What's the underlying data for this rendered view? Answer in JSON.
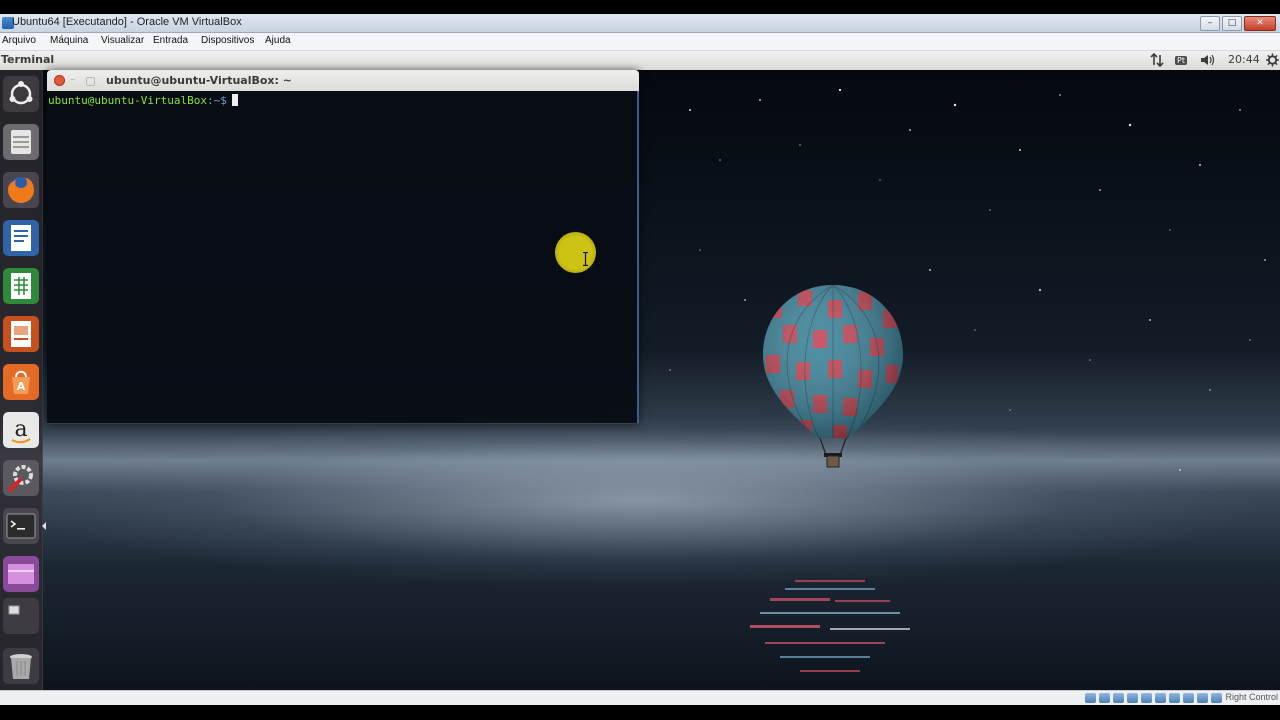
{
  "host_window": {
    "title": "Ubuntu64 [Executando] - Oracle VM VirtualBox",
    "menu": [
      "Arquivo",
      "Máquina",
      "Visualizar",
      "Entrada",
      "Dispositivos",
      "Ajuda"
    ]
  },
  "ubuntu_panel": {
    "app_title": "Terminal",
    "keyboard_layout": "Pt",
    "clock": "20:44"
  },
  "launcher": {
    "items": [
      "ubuntu-dash",
      "files",
      "firefox",
      "libreoffice-writer",
      "libreoffice-calc",
      "libreoffice-impress",
      "ubuntu-software-center",
      "amazon",
      "system-settings",
      "terminal",
      "workspaces",
      "virtualbox-window",
      "trash"
    ]
  },
  "terminal": {
    "title": "ubuntu@ubuntu-VirtualBox: ~",
    "prompt_user": "ubuntu@ubuntu-VirtualBox",
    "prompt_path": ":~$"
  },
  "status_bar": {
    "host_key": "Right Control"
  },
  "colors": {
    "terminal_prompt_user": "#8ae234",
    "terminal_prompt_path": "#729fcf",
    "close_button": "#e05a3c",
    "mouse_highlight": "#d7cd14"
  }
}
